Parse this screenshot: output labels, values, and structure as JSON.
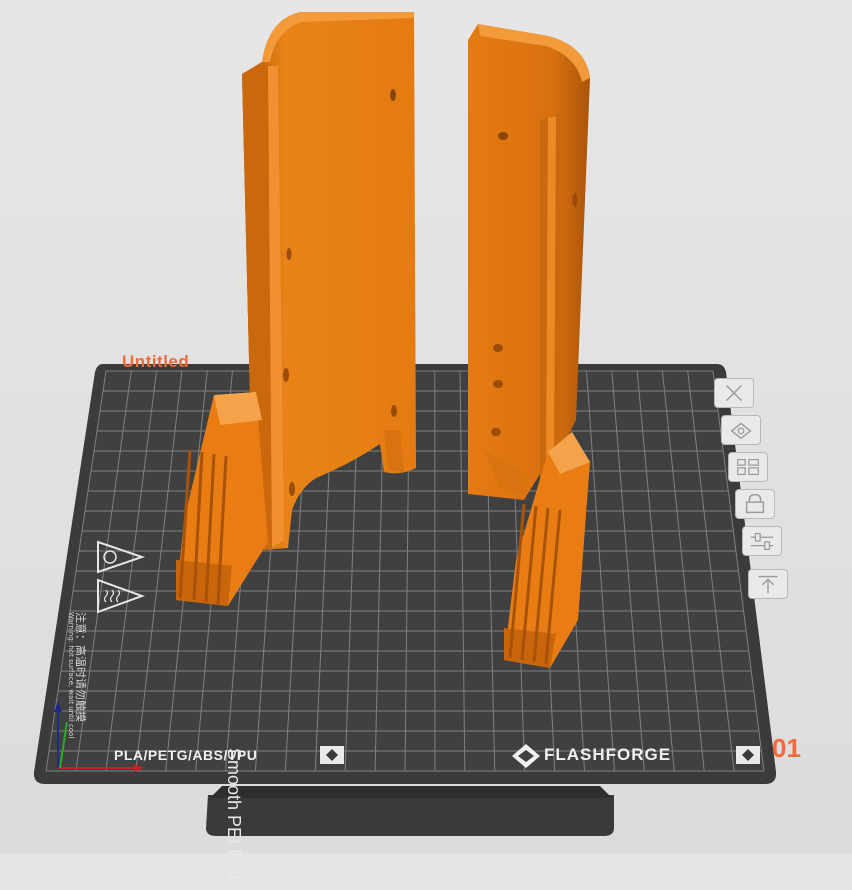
{
  "plate": {
    "name": "Untitled",
    "number": "01",
    "type": "Smooth PEI Plate",
    "filaments": "PLA/PETG/ABS/TPU",
    "brand": "FLASHFORGE",
    "warning_title": "注意：高温时请勿触摸",
    "warning_subtitle": "Warning: hot surface, wait until cool"
  },
  "plate_tools": [
    {
      "name": "close-plate-button",
      "icon": "close-icon"
    },
    {
      "name": "auto-orient-button",
      "icon": "orient-icon"
    },
    {
      "name": "arrange-button",
      "icon": "arrange-icon"
    },
    {
      "name": "lock-plate-button",
      "icon": "lock-icon"
    },
    {
      "name": "plate-settings-button",
      "icon": "sliders-icon"
    },
    {
      "name": "move-plate-button",
      "icon": "move-icon"
    }
  ],
  "colors": {
    "background": "#e4e4e4",
    "plate": "#3b3b3b",
    "grid": "#8a8a8a",
    "model": "#e77a12",
    "accent": "#f06a3a"
  }
}
